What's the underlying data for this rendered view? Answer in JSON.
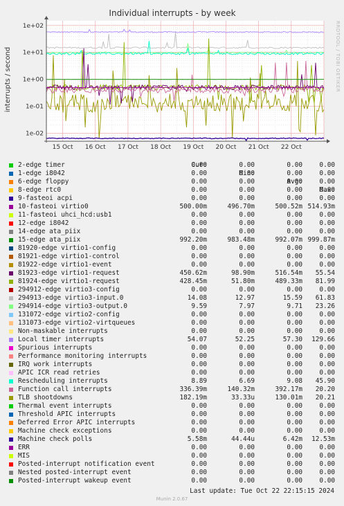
{
  "title": "Individual interrupts - by week",
  "side_label": "RRDTOOL / TOBI OETIKER",
  "last_update": "Last update: Tue Oct 22 22:15:15 2024",
  "footer": "Munin 2.0.67",
  "columns": [
    "Cur:",
    "Min:",
    "Avg:",
    "Max:"
  ],
  "chart_data": {
    "type": "line",
    "ylabel": "interrupts / second",
    "yscale": "log",
    "ylim": [
      0.005,
      150
    ],
    "yticks": [
      "1e-02",
      "1e-01",
      "1e+00",
      "1e+01",
      "1e+02"
    ],
    "x_range": [
      "Oct 14 12:00",
      "Oct 23 00:00"
    ],
    "xticks": [
      "15 Oct",
      "16 Oct",
      "17 Oct",
      "18 Oct",
      "19 Oct",
      "20 Oct",
      "21 Oct",
      "22 Oct"
    ],
    "grid": true,
    "series": [
      {
        "name": "2-edge timer",
        "color": "#00cc00",
        "cur": "0.00",
        "min": "0.00",
        "avg": "0.00",
        "max": "0.00"
      },
      {
        "name": "1-edge i8042",
        "color": "#0066b3",
        "cur": "0.00",
        "min": "0.00",
        "avg": "0.00",
        "max": "0.00"
      },
      {
        "name": "6-edge floppy",
        "color": "#ff8000",
        "cur": "0.00",
        "min": "0.00",
        "avg": "0.00",
        "max": "0.00"
      },
      {
        "name": "8-edge rtc0",
        "color": "#ffcc00",
        "cur": "0.00",
        "min": "0.00",
        "avg": "0.00",
        "max": "0.00"
      },
      {
        "name": "9-fasteoi acpi",
        "color": "#330099",
        "cur": "0.00",
        "min": "0.00",
        "avg": "0.00",
        "max": "0.00"
      },
      {
        "name": "10-fasteoi virtio0",
        "color": "#990099",
        "cur": "500.00m",
        "min": "496.70m",
        "avg": "500.52m",
        "max": "514.93m"
      },
      {
        "name": "11-fasteoi uhci_hcd:usb1",
        "color": "#ccff00",
        "cur": "0.00",
        "min": "0.00",
        "avg": "0.00",
        "max": "0.00"
      },
      {
        "name": "12-edge i8042",
        "color": "#ff0000",
        "cur": "0.00",
        "min": "0.00",
        "avg": "0.00",
        "max": "0.00"
      },
      {
        "name": "14-edge ata_piix",
        "color": "#808080",
        "cur": "0.00",
        "min": "0.00",
        "avg": "0.00",
        "max": "0.00"
      },
      {
        "name": "15-edge ata_piix",
        "color": "#008f00",
        "cur": "992.20m",
        "min": "983.48m",
        "avg": "992.07m",
        "max": "999.87m"
      },
      {
        "name": "81920-edge virtio1-config",
        "color": "#00487d",
        "cur": "0.00",
        "min": "0.00",
        "avg": "0.00",
        "max": "0.00"
      },
      {
        "name": "81921-edge virtio1-control",
        "color": "#b35a00",
        "cur": "0.00",
        "min": "0.00",
        "avg": "0.00",
        "max": "0.00"
      },
      {
        "name": "81922-edge virtio1-event",
        "color": "#b38f00",
        "cur": "0.00",
        "min": "0.00",
        "avg": "0.00",
        "max": "0.00"
      },
      {
        "name": "81923-edge virtio1-request",
        "color": "#6b006b",
        "cur": "450.62m",
        "min": "98.90m",
        "avg": "516.54m",
        "max": "55.54"
      },
      {
        "name": "81924-edge virtio1-request",
        "color": "#8fb300",
        "cur": "428.45m",
        "min": "51.80m",
        "avg": "489.33m",
        "max": "81.99"
      },
      {
        "name": "294912-edge virtio3-config",
        "color": "#b30000",
        "cur": "0.00",
        "min": "0.00",
        "avg": "0.00",
        "max": "0.00"
      },
      {
        "name": "294913-edge virtio3-input.0",
        "color": "#bebebe",
        "cur": "14.08",
        "min": "12.97",
        "avg": "15.59",
        "max": "61.83"
      },
      {
        "name": "294914-edge virtio3-output.0",
        "color": "#80ff80",
        "cur": "9.59",
        "min": "7.97",
        "avg": "9.71",
        "max": "23.26"
      },
      {
        "name": "131072-edge virtio2-config",
        "color": "#80c9ff",
        "cur": "0.00",
        "min": "0.00",
        "avg": "0.00",
        "max": "0.00"
      },
      {
        "name": "131073-edge virtio2-virtqueues",
        "color": "#ffc080",
        "cur": "0.00",
        "min": "0.00",
        "avg": "0.00",
        "max": "0.00"
      },
      {
        "name": "Non-maskable interrupts",
        "color": "#ffe680",
        "cur": "0.00",
        "min": "0.00",
        "avg": "0.00",
        "max": "0.00"
      },
      {
        "name": "Local timer interrupts",
        "color": "#aa80ff",
        "cur": "54.07",
        "min": "52.25",
        "avg": "57.30",
        "max": "129.66"
      },
      {
        "name": "Spurious interrupts",
        "color": "#ee00cc",
        "cur": "0.00",
        "min": "0.00",
        "avg": "0.00",
        "max": "0.00"
      },
      {
        "name": "Performance monitoring interrupts",
        "color": "#ff8080",
        "cur": "0.00",
        "min": "0.00",
        "avg": "0.00",
        "max": "0.00"
      },
      {
        "name": "IRQ work interrupts",
        "color": "#666600",
        "cur": "0.00",
        "min": "0.00",
        "avg": "0.00",
        "max": "0.00"
      },
      {
        "name": "APIC ICR read retries",
        "color": "#ffbfff",
        "cur": "0.00",
        "min": "0.00",
        "avg": "0.00",
        "max": "0.00"
      },
      {
        "name": "Rescheduling interrupts",
        "color": "#00ffcc",
        "cur": "8.89",
        "min": "6.69",
        "avg": "9.08",
        "max": "45.90"
      },
      {
        "name": "Function call interrupts",
        "color": "#cc6699",
        "cur": "336.39m",
        "min": "140.32m",
        "avg": "392.17m",
        "max": "20.20"
      },
      {
        "name": "TLB shootdowns",
        "color": "#999900",
        "cur": "182.19m",
        "min": "33.33u",
        "avg": "130.01m",
        "max": "20.21"
      },
      {
        "name": "Thermal event interrupts",
        "color": "#00cc00",
        "cur": "0.00",
        "min": "0.00",
        "avg": "0.00",
        "max": "0.00"
      },
      {
        "name": "Threshold APIC interrupts",
        "color": "#0066b3",
        "cur": "0.00",
        "min": "0.00",
        "avg": "0.00",
        "max": "0.00"
      },
      {
        "name": "Deferred Error APIC interrupts",
        "color": "#ff8000",
        "cur": "0.00",
        "min": "0.00",
        "avg": "0.00",
        "max": "0.00"
      },
      {
        "name": "Machine check exceptions",
        "color": "#ffcc00",
        "cur": "0.00",
        "min": "0.00",
        "avg": "0.00",
        "max": "0.00"
      },
      {
        "name": "Machine check polls",
        "color": "#330099",
        "cur": "5.58m",
        "min": "44.44u",
        "avg": "6.42m",
        "max": "12.53m"
      },
      {
        "name": "ERR",
        "color": "#990099",
        "cur": "0.00",
        "min": "0.00",
        "avg": "0.00",
        "max": "0.00"
      },
      {
        "name": "MIS",
        "color": "#ccff00",
        "cur": "0.00",
        "min": "0.00",
        "avg": "0.00",
        "max": "0.00"
      },
      {
        "name": "Posted-interrupt notification event",
        "color": "#ff0000",
        "cur": "0.00",
        "min": "0.00",
        "avg": "0.00",
        "max": "0.00"
      },
      {
        "name": "Nested posted-interrupt event",
        "color": "#808080",
        "cur": "0.00",
        "min": "0.00",
        "avg": "0.00",
        "max": "0.00"
      },
      {
        "name": "Posted-interrupt wakeup event",
        "color": "#008f00",
        "cur": "0.00",
        "min": "0.00",
        "avg": "0.00",
        "max": "0.00"
      }
    ]
  }
}
